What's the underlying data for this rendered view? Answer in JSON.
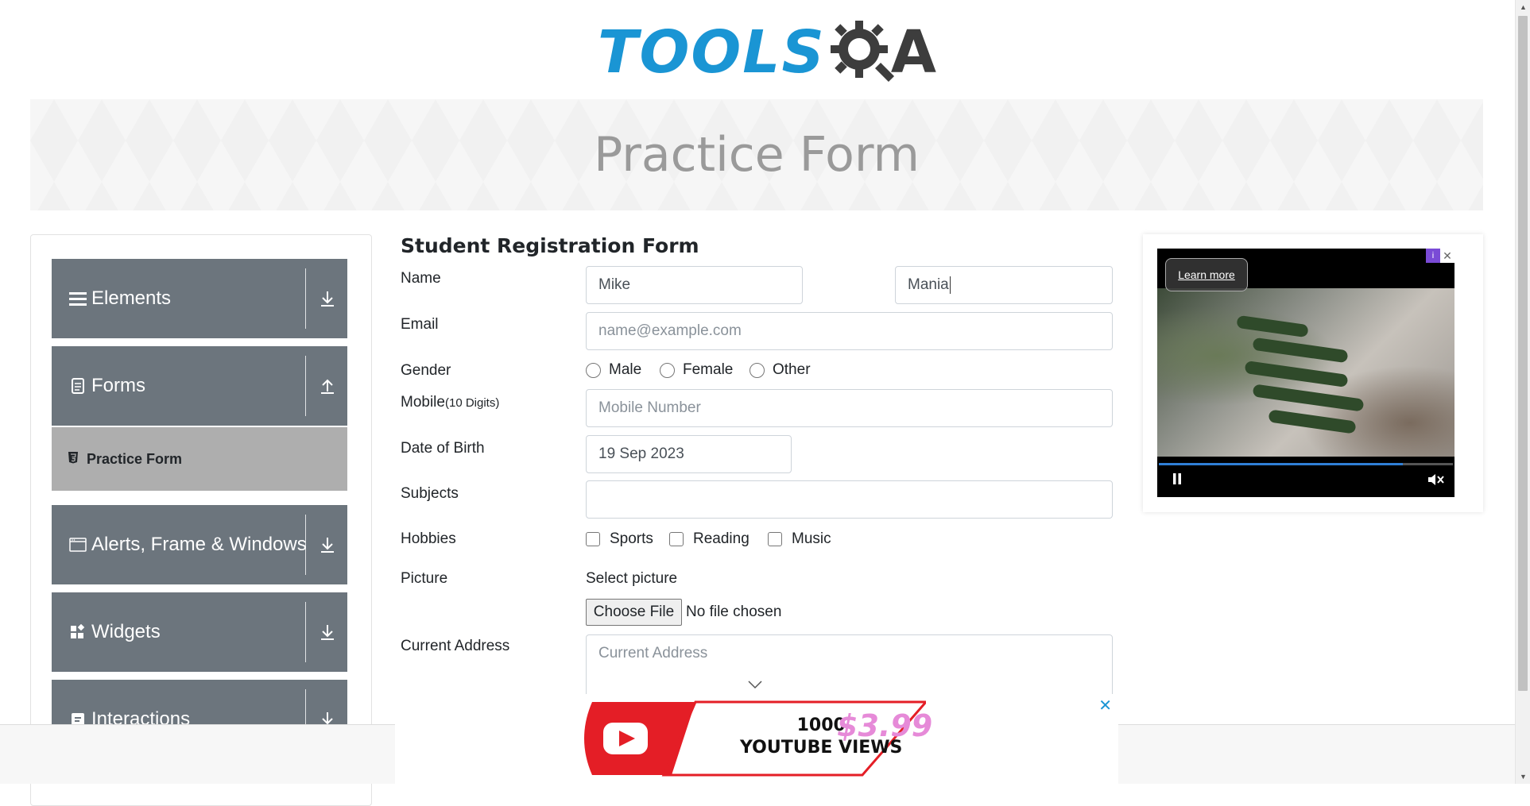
{
  "header": {
    "logo_text_left": "TOOLS",
    "logo_text_right": "A"
  },
  "banner": {
    "title": "Practice Form"
  },
  "sidebar": {
    "groups": [
      {
        "label": "Elements",
        "icon": "hamburger-icon",
        "expanded": false
      },
      {
        "label": "Forms",
        "icon": "document-icon",
        "expanded": true
      },
      {
        "label": "Alerts, Frame & Windows",
        "icon": "window-icon",
        "expanded": false
      },
      {
        "label": "Widgets",
        "icon": "widgets-icon",
        "expanded": false
      },
      {
        "label": "Interactions",
        "icon": "interactions-icon",
        "expanded": false
      }
    ],
    "active_item": "Practice Form"
  },
  "form": {
    "title": "Student Registration Form",
    "name_label": "Name",
    "first_name": "Mike",
    "last_name": "Mania",
    "email_label": "Email",
    "email_placeholder": "name@example.com",
    "gender_label": "Gender",
    "gender_options": [
      "Male",
      "Female",
      "Other"
    ],
    "mobile_label": "Mobile",
    "mobile_hint": "(10 Digits)",
    "mobile_placeholder": "Mobile Number",
    "dob_label": "Date of Birth",
    "dob_value": "19 Sep 2023",
    "subjects_label": "Subjects",
    "subjects_value": "",
    "hobbies_label": "Hobbies",
    "hobbies_options": [
      "Sports",
      "Reading",
      "Music"
    ],
    "picture_label": "Picture",
    "select_picture": "Select picture",
    "choose_file": "Choose File",
    "no_file": "No file chosen",
    "address_label": "Current Address",
    "address_placeholder": "Current Address"
  },
  "video_ad": {
    "learn_more": "Learn more",
    "progress": 0.83
  },
  "bottom_ad": {
    "line1": "1000",
    "line2": "YOUTUBE VIEWS",
    "price": "$3.99"
  },
  "colors": {
    "brand_blue": "#1a95d4",
    "sidebar_gray": "#6c757d",
    "active_item": "#aeaeae"
  }
}
